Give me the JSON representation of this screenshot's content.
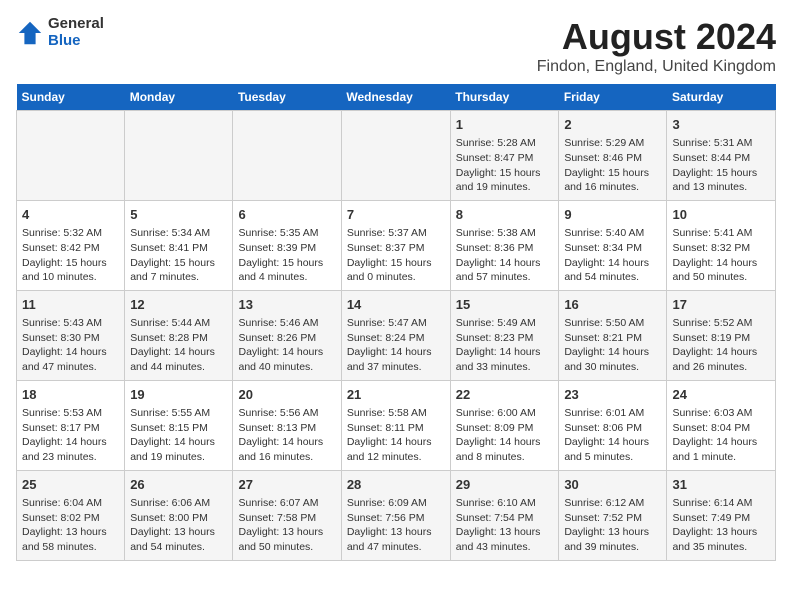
{
  "logo": {
    "general": "General",
    "blue": "Blue"
  },
  "title": "August 2024",
  "subtitle": "Findon, England, United Kingdom",
  "days_of_week": [
    "Sunday",
    "Monday",
    "Tuesday",
    "Wednesday",
    "Thursday",
    "Friday",
    "Saturday"
  ],
  "weeks": [
    [
      {
        "day": "",
        "info": ""
      },
      {
        "day": "",
        "info": ""
      },
      {
        "day": "",
        "info": ""
      },
      {
        "day": "",
        "info": ""
      },
      {
        "day": "1",
        "info": "Sunrise: 5:28 AM\nSunset: 8:47 PM\nDaylight: 15 hours\nand 19 minutes."
      },
      {
        "day": "2",
        "info": "Sunrise: 5:29 AM\nSunset: 8:46 PM\nDaylight: 15 hours\nand 16 minutes."
      },
      {
        "day": "3",
        "info": "Sunrise: 5:31 AM\nSunset: 8:44 PM\nDaylight: 15 hours\nand 13 minutes."
      }
    ],
    [
      {
        "day": "4",
        "info": "Sunrise: 5:32 AM\nSunset: 8:42 PM\nDaylight: 15 hours\nand 10 minutes."
      },
      {
        "day": "5",
        "info": "Sunrise: 5:34 AM\nSunset: 8:41 PM\nDaylight: 15 hours\nand 7 minutes."
      },
      {
        "day": "6",
        "info": "Sunrise: 5:35 AM\nSunset: 8:39 PM\nDaylight: 15 hours\nand 4 minutes."
      },
      {
        "day": "7",
        "info": "Sunrise: 5:37 AM\nSunset: 8:37 PM\nDaylight: 15 hours\nand 0 minutes."
      },
      {
        "day": "8",
        "info": "Sunrise: 5:38 AM\nSunset: 8:36 PM\nDaylight: 14 hours\nand 57 minutes."
      },
      {
        "day": "9",
        "info": "Sunrise: 5:40 AM\nSunset: 8:34 PM\nDaylight: 14 hours\nand 54 minutes."
      },
      {
        "day": "10",
        "info": "Sunrise: 5:41 AM\nSunset: 8:32 PM\nDaylight: 14 hours\nand 50 minutes."
      }
    ],
    [
      {
        "day": "11",
        "info": "Sunrise: 5:43 AM\nSunset: 8:30 PM\nDaylight: 14 hours\nand 47 minutes."
      },
      {
        "day": "12",
        "info": "Sunrise: 5:44 AM\nSunset: 8:28 PM\nDaylight: 14 hours\nand 44 minutes."
      },
      {
        "day": "13",
        "info": "Sunrise: 5:46 AM\nSunset: 8:26 PM\nDaylight: 14 hours\nand 40 minutes."
      },
      {
        "day": "14",
        "info": "Sunrise: 5:47 AM\nSunset: 8:24 PM\nDaylight: 14 hours\nand 37 minutes."
      },
      {
        "day": "15",
        "info": "Sunrise: 5:49 AM\nSunset: 8:23 PM\nDaylight: 14 hours\nand 33 minutes."
      },
      {
        "day": "16",
        "info": "Sunrise: 5:50 AM\nSunset: 8:21 PM\nDaylight: 14 hours\nand 30 minutes."
      },
      {
        "day": "17",
        "info": "Sunrise: 5:52 AM\nSunset: 8:19 PM\nDaylight: 14 hours\nand 26 minutes."
      }
    ],
    [
      {
        "day": "18",
        "info": "Sunrise: 5:53 AM\nSunset: 8:17 PM\nDaylight: 14 hours\nand 23 minutes."
      },
      {
        "day": "19",
        "info": "Sunrise: 5:55 AM\nSunset: 8:15 PM\nDaylight: 14 hours\nand 19 minutes."
      },
      {
        "day": "20",
        "info": "Sunrise: 5:56 AM\nSunset: 8:13 PM\nDaylight: 14 hours\nand 16 minutes."
      },
      {
        "day": "21",
        "info": "Sunrise: 5:58 AM\nSunset: 8:11 PM\nDaylight: 14 hours\nand 12 minutes."
      },
      {
        "day": "22",
        "info": "Sunrise: 6:00 AM\nSunset: 8:09 PM\nDaylight: 14 hours\nand 8 minutes."
      },
      {
        "day": "23",
        "info": "Sunrise: 6:01 AM\nSunset: 8:06 PM\nDaylight: 14 hours\nand 5 minutes."
      },
      {
        "day": "24",
        "info": "Sunrise: 6:03 AM\nSunset: 8:04 PM\nDaylight: 14 hours\nand 1 minute."
      }
    ],
    [
      {
        "day": "25",
        "info": "Sunrise: 6:04 AM\nSunset: 8:02 PM\nDaylight: 13 hours\nand 58 minutes."
      },
      {
        "day": "26",
        "info": "Sunrise: 6:06 AM\nSunset: 8:00 PM\nDaylight: 13 hours\nand 54 minutes."
      },
      {
        "day": "27",
        "info": "Sunrise: 6:07 AM\nSunset: 7:58 PM\nDaylight: 13 hours\nand 50 minutes."
      },
      {
        "day": "28",
        "info": "Sunrise: 6:09 AM\nSunset: 7:56 PM\nDaylight: 13 hours\nand 47 minutes."
      },
      {
        "day": "29",
        "info": "Sunrise: 6:10 AM\nSunset: 7:54 PM\nDaylight: 13 hours\nand 43 minutes."
      },
      {
        "day": "30",
        "info": "Sunrise: 6:12 AM\nSunset: 7:52 PM\nDaylight: 13 hours\nand 39 minutes."
      },
      {
        "day": "31",
        "info": "Sunrise: 6:14 AM\nSunset: 7:49 PM\nDaylight: 13 hours\nand 35 minutes."
      }
    ]
  ]
}
